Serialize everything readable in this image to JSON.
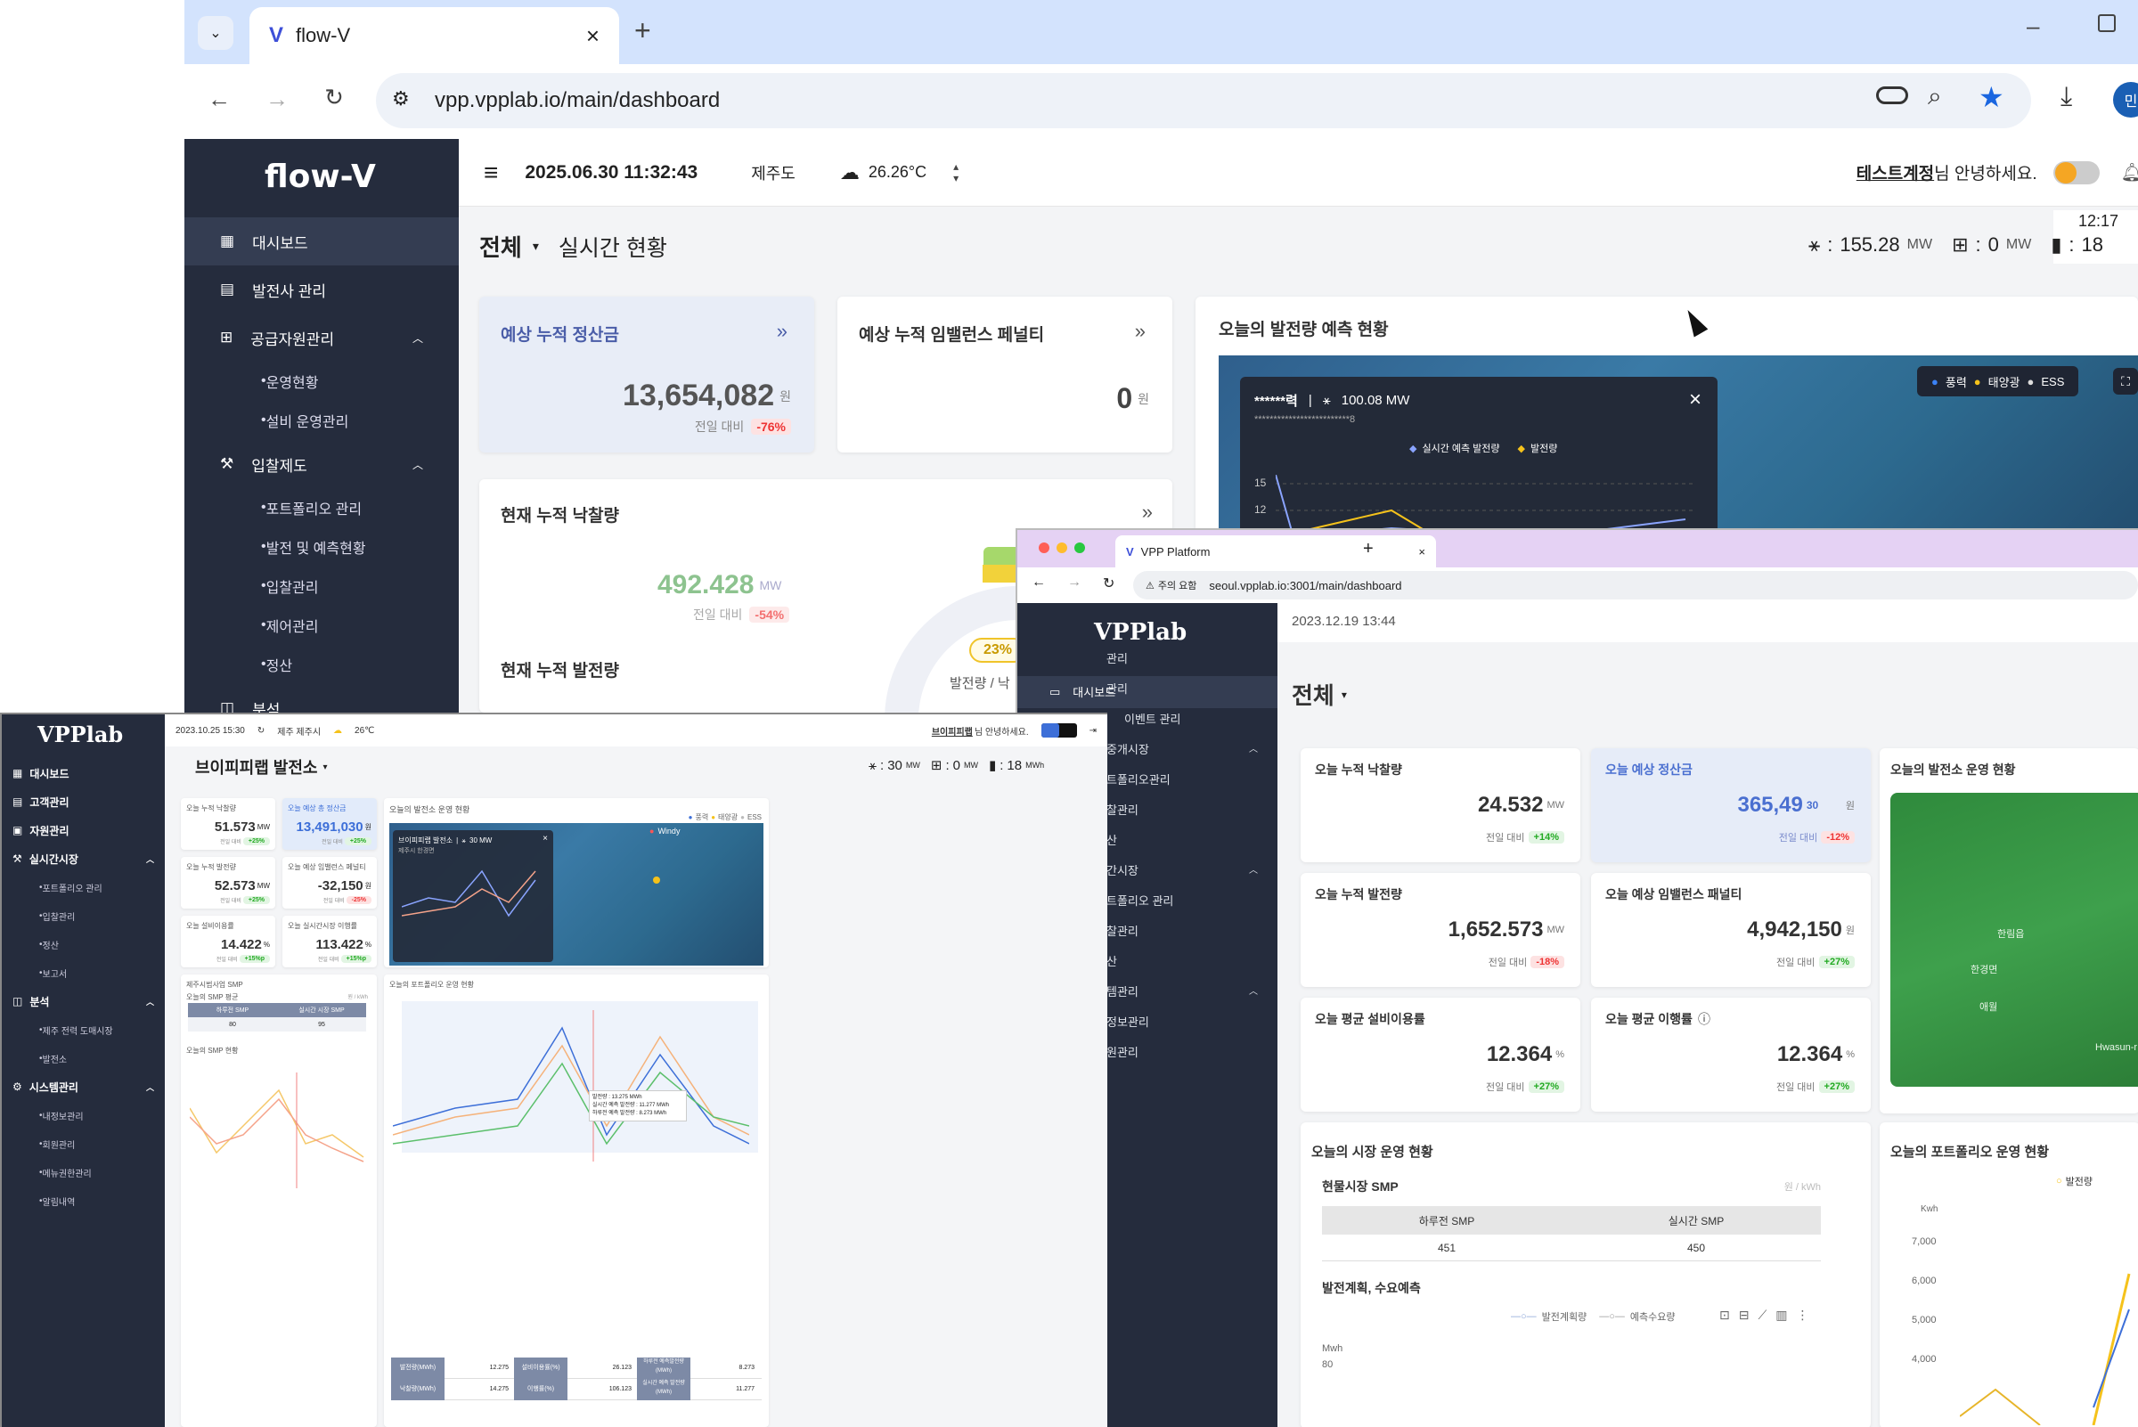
{
  "browser": {
    "tab_title": "flow-V",
    "url": "vpp.vpplab.io/main/dashboard",
    "profile": "민"
  },
  "flowv": {
    "logo": "flow-V",
    "datetime": "2025.06.30 11:32:43",
    "region": "제주도",
    "temperature": "26.26°C",
    "user_greeting_name": "테스트계정",
    "user_greeting_suffix": "님 안녕하세요.",
    "clock": "12:17",
    "sidebar": [
      {
        "label": "대시보드",
        "icon": "grid-icon"
      },
      {
        "label": "발전사 관리",
        "icon": "document-icon"
      },
      {
        "label": "공급자원관리",
        "icon": "plus-box-icon"
      },
      {
        "label": "운영현황"
      },
      {
        "label": "설비 운영관리"
      },
      {
        "label": "입찰제도",
        "icon": "gavel-icon"
      },
      {
        "label": "포트폴리오 관리"
      },
      {
        "label": "발전 및 예측현황"
      },
      {
        "label": "입찰관리"
      },
      {
        "label": "제어관리"
      },
      {
        "label": "정산"
      },
      {
        "label": "분석",
        "icon": "chart-icon"
      }
    ],
    "page": {
      "scope": "전체",
      "subtitle": "실시간 현황",
      "wind_value": "155.28",
      "wind_unit": "MW",
      "solar_value": "0",
      "solar_unit": "MW",
      "ess_value": "18"
    },
    "cards": {
      "settle_title": "예상 누적 정산금",
      "settle_value": "13,654,082",
      "settle_unit": "원",
      "settle_cmp": "전일 대비",
      "settle_delta": "-76%",
      "penalty_title": "예상 누적 임밸런스 페널티",
      "penalty_value": "0",
      "penalty_unit": "원",
      "bid_title": "현재 누적 낙찰량",
      "bid_value": "492.428",
      "bid_unit": "MW",
      "bid_cmp": "전일 대비",
      "bid_delta": "-54%",
      "gen_title": "현재 누적 발전량",
      "donut_pct": "23%",
      "donut_label": "발전량 / 낙",
      "forecast_title": "오늘의 발전량 예측 현황",
      "popup_name": "******력",
      "popup_value": "100.08 MW",
      "popup_sub": "*************************8",
      "popup_legend_a": "실시간 예측 발전량",
      "popup_legend_b": "발전량",
      "popup_y15": "15",
      "popup_y12": "12",
      "legend_wind": "풍력",
      "legend_solar": "태양광",
      "legend_ess": "ESS"
    }
  },
  "vpp": {
    "tab_title": "VPP Platform",
    "warn": "주의 요함",
    "url": "seoul.vpplab.io:3001/main/dashboard",
    "logo": "VPPlab",
    "datetime": "2023.12.19 13:44",
    "scope": "전체",
    "sidebar": [
      "대시보드",
      "관리",
      "관리",
      "이벤트 관리",
      "중개시장",
      "트폴리오관리",
      "찰관리",
      "산",
      "간시장",
      "트폴리오 관리",
      "찰관리",
      "산",
      "템관리",
      "정보관리",
      "원관리"
    ],
    "kpis": [
      {
        "title": "오늘 누적 낙찰량",
        "value": "24.532",
        "unit": "MW",
        "cmp": "전일 대비",
        "delta": "+14%",
        "tone": "up"
      },
      {
        "title": "오늘 예상 정산금",
        "value": "365,49",
        "value2": "30",
        "unit": "원",
        "cmp": "전일 대비",
        "delta": "-12%",
        "tone": "down"
      },
      {
        "title": "오늘 누적 발전량",
        "value": "1,652.573",
        "unit": "MW",
        "cmp": "전일 대비",
        "delta": "-18%",
        "tone": "down"
      },
      {
        "title": "오늘 예상 임밸런스 패널티",
        "value": "4,942,150",
        "unit": "원",
        "cmp": "전일 대비",
        "delta": "+27%",
        "tone": "up"
      },
      {
        "title": "오늘 평균 설비이용률",
        "value": "12.364",
        "unit": "%",
        "cmp": "전일 대비",
        "delta": "+27%",
        "tone": "up"
      },
      {
        "title": "오늘 평균 이행률",
        "value": "12.364",
        "unit": "%",
        "cmp": "전일 대비",
        "delta": "+27%",
        "tone": "up"
      }
    ],
    "plant_status_title": "오늘의 발전소 운영 현황",
    "map_labels": [
      "한림읍",
      "한경면",
      "애월",
      "Hwasun-r"
    ],
    "market_title": "오늘의 시장 운영 현황",
    "smp_title": "현물시장 SMP",
    "smp_unit": "원 / kWh",
    "smp_headers": [
      "하루전 SMP",
      "실시간 SMP"
    ],
    "smp_values": [
      "451",
      "450"
    ],
    "plan_title": "발전계획, 수요예측",
    "plan_legend": [
      "발전계획량",
      "예측수요량"
    ],
    "plan_unit": "Mwh",
    "plan_y": "80",
    "portfolio_title": "오늘의 포트폴리오 운영 현황",
    "portfolio_legend": "발전량",
    "portfolio_unit": "Kwh",
    "portfolio_ticks": [
      "7,000",
      "6,000",
      "5,000",
      "4,000"
    ]
  },
  "vpplab": {
    "logo": "VPPlab",
    "datetime": "2023.10.25 15:30",
    "region": "제주 제주시",
    "temp": "26℃",
    "greeting_name": "브이피피랩",
    "greeting_suffix": "님 안녕하세요.",
    "plant": "브이피피랩 발전소",
    "wind": "30",
    "wind_unit": "MW",
    "solar": "0",
    "solar_unit": "MW",
    "ess": "18",
    "ess_unit": "MWh",
    "sidebar": [
      {
        "label": "대시보드",
        "type": "item"
      },
      {
        "label": "고객관리",
        "type": "item"
      },
      {
        "label": "자원관리",
        "type": "item"
      },
      {
        "label": "실시간시장",
        "type": "item"
      },
      {
        "label": "포트폴리오 관리",
        "type": "sub"
      },
      {
        "label": "입찰관리",
        "type": "sub"
      },
      {
        "label": "정산",
        "type": "sub"
      },
      {
        "label": "보고서",
        "type": "sub"
      },
      {
        "label": "분석",
        "type": "item"
      },
      {
        "label": "제주 전력 도매시장",
        "type": "sub"
      },
      {
        "label": "발전소",
        "type": "sub"
      },
      {
        "label": "시스템관리",
        "type": "item"
      },
      {
        "label": "내정보관리",
        "type": "sub"
      },
      {
        "label": "회원관리",
        "type": "sub"
      },
      {
        "label": "메뉴권한관리",
        "type": "sub"
      },
      {
        "label": "알림내역",
        "type": "sub"
      }
    ],
    "kpis": [
      {
        "title": "오늘 누적 낙찰량",
        "value": "51.573",
        "unit": "MW",
        "cmp": "전일 대비",
        "delta": "+25%"
      },
      {
        "title": "오늘 예상 총 정산금",
        "value": "13,491,030",
        "unit": "원",
        "cmp": "전일 대비",
        "delta": "+25%"
      },
      {
        "title": "오늘 누적 발전량",
        "value": "52.573",
        "unit": "MW",
        "cmp": "전일 대비",
        "delta": "+25%"
      },
      {
        "title": "오늘 예상 임밸런스 페널티",
        "value": "-32,150",
        "unit": "원",
        "cmp": "전일 대비",
        "delta": "-25%"
      },
      {
        "title": "오늘 설비이용률",
        "value": "14.422",
        "unit": "%",
        "cmp": "전일 대비",
        "delta": "+15%p"
      },
      {
        "title": "오늘 실시간시장 이행률",
        "value": "113.422",
        "unit": "%",
        "cmp": "전일 대비",
        "delta": "+15%p"
      }
    ],
    "map_title": "오늘의 발전소 운영 현황",
    "map_legend": [
      "풍력",
      "태양광",
      "ESS"
    ],
    "popup_title": "브이피피랩 발전소",
    "popup_value": "30 MW",
    "popup_region": "제주시 한경면",
    "windy": "Windy",
    "smp_section": "제주시범사업 SMP",
    "smp_today": "오늘의 SMP 평균",
    "smp_unit": "원 / kWh",
    "smp_headers": [
      "하루전 SMP",
      "실시간 시장 SMP"
    ],
    "smp_values": [
      "80",
      "95"
    ],
    "smp_trend": "오늘의 SMP 현황",
    "portfolio_title": "오늘의 포트폴리오 운영 현황",
    "table": [
      [
        "발전량(MWh)",
        "12.275",
        "설비이용률(%)",
        "26.123",
        "하루전 예측발전량(MWh)",
        "8.273"
      ],
      [
        "낙찰량(MWh)",
        "14.275",
        "이행률(%)",
        "106.123",
        "실시간 예측 발전량(MWh)",
        "11.277"
      ]
    ],
    "tooltip": [
      "발전량 : 13.275 MWh",
      "실시간 예측 발전량 : 11.277 MWh",
      "하루전 예측 발전량 : 8.273 MWh"
    ]
  },
  "colors": {
    "sidebar": "#252c3d",
    "accent_blue": "#3d6fd8",
    "green": "#5bbf6b",
    "red": "#e33b3b",
    "yellow": "#f5c21b"
  }
}
